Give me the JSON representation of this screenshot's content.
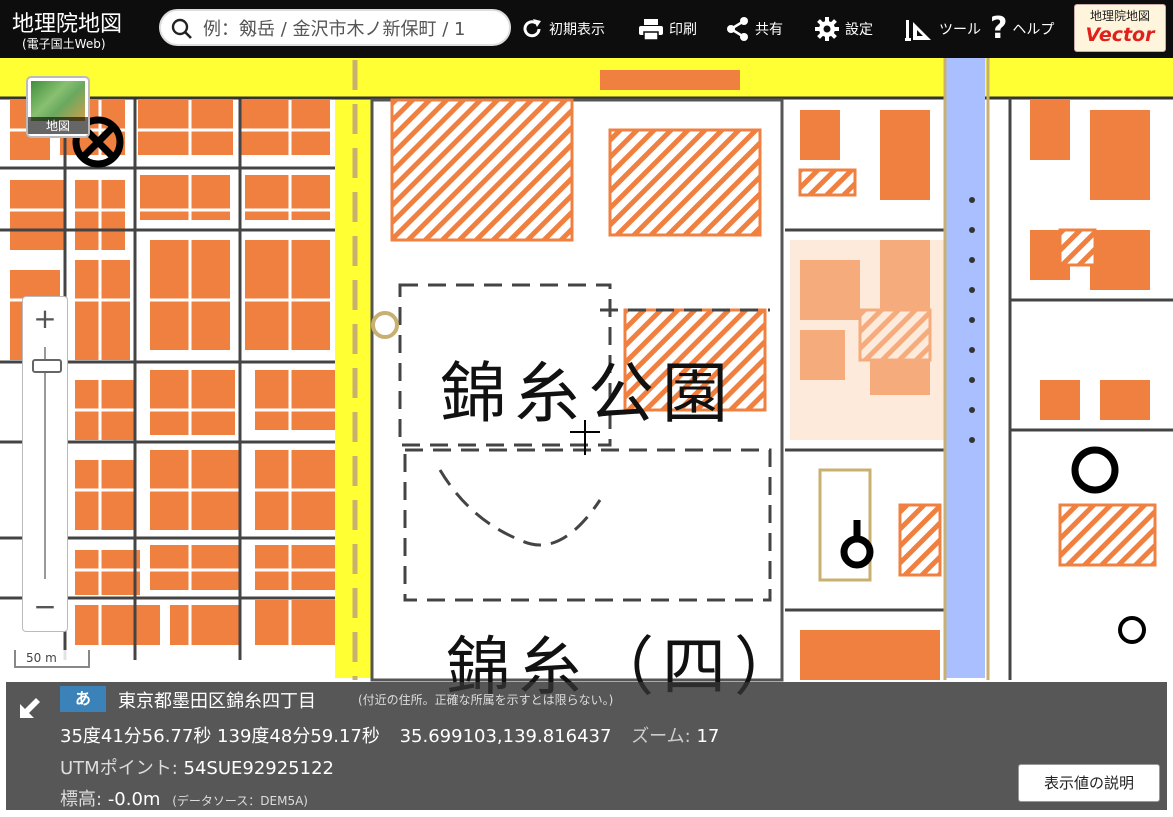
{
  "header": {
    "title": "地理院地図",
    "subtitle": "(電子国土Web)",
    "search_placeholder": "例：剱岳 / 金沢市木ノ新保町 / 1",
    "buttons": {
      "reset": "初期表示",
      "print": "印刷",
      "share": "共有",
      "settings": "設定",
      "tools": "ツール",
      "help": "ヘルプ"
    },
    "vector_badge": {
      "top": "地理院地図",
      "bottom": "Vector"
    }
  },
  "map": {
    "layer_button_label": "地図",
    "zoom_in": "+",
    "zoom_out": "−",
    "scale_label": "50 m",
    "labels": {
      "park": "錦糸公園",
      "area": "錦糸（四）"
    }
  },
  "info": {
    "lang_badge": "あ",
    "address": "東京都墨田区錦糸四丁目",
    "address_note": "(付近の住所。正確な所属を示すとは限らない。)",
    "dms": "35度41分56.77秒 139度48分59.17秒",
    "decimal": "35.699103,139.816437",
    "zoom_label": "ズーム:",
    "zoom_value": "17",
    "utm_label": "UTMポイント:",
    "utm_value": "54SUE92925122",
    "elev_label": "標高:",
    "elev_value": "-0.0m",
    "elev_note": "(データソース：DEM5A)",
    "explain_button": "表示値の説明"
  },
  "colors": {
    "building": "#f08040",
    "building_light": "#fcd6b8",
    "major_road": "#ffff33",
    "river": "#a9bfff",
    "header_bg": "#0d0d0d",
    "badge_blue": "#3a82b8",
    "vector_red": "#e0201a"
  },
  "icons": [
    "search-icon",
    "reload-icon",
    "printer-icon",
    "share-icon",
    "gear-icon",
    "tools-icon",
    "help-icon",
    "collapse-arrow-icon"
  ]
}
